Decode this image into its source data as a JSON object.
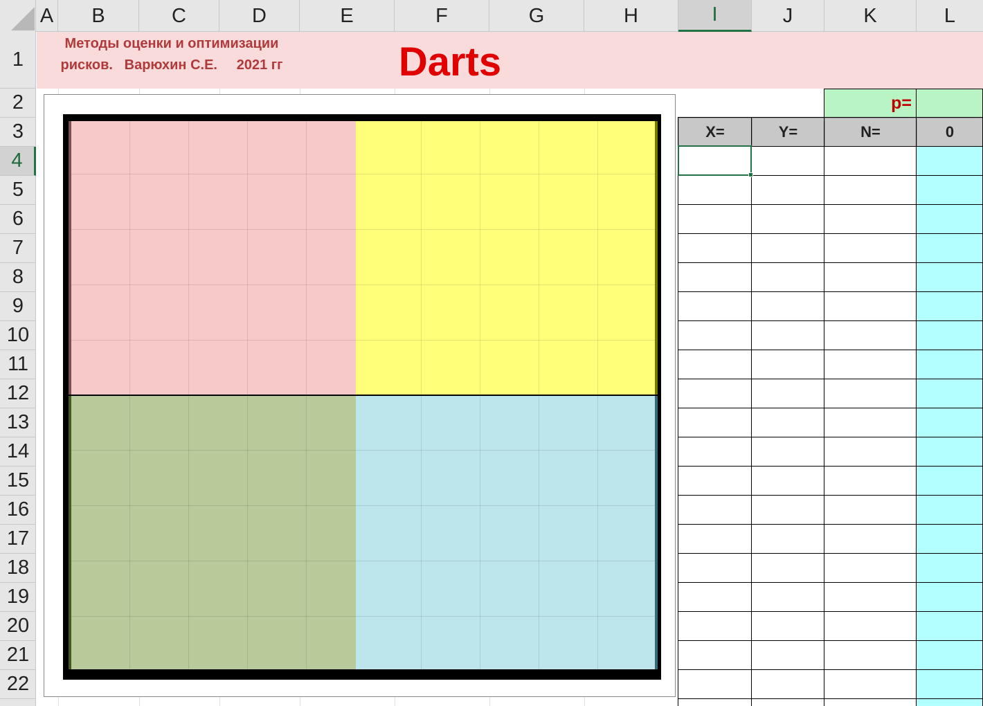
{
  "columns": [
    "A",
    "B",
    "C",
    "D",
    "E",
    "F",
    "G",
    "H",
    "I",
    "J",
    "K",
    "L"
  ],
  "selected_column": "I",
  "rows": [
    "1",
    "2",
    "3",
    "4",
    "5",
    "6",
    "7",
    "8",
    "9",
    "10",
    "11",
    "12",
    "13",
    "14",
    "15",
    "16",
    "17",
    "18",
    "19",
    "20",
    "21",
    "22"
  ],
  "selected_row": "4",
  "header": {
    "subtitle_line1": "Методы оценки и оптимизации",
    "subtitle_line2": "рисков.   Варюхин С.Е.     2021 гг",
    "title": "Darts"
  },
  "table": {
    "p_label": "p=",
    "p_value": "",
    "col_headers": [
      "X=",
      "Y=",
      "N=",
      "0"
    ]
  },
  "board": {
    "quadrant_colors": {
      "top_left": "#f7c9c9",
      "top_right": "#ffff7a",
      "bottom_left": "#b8c99a",
      "bottom_right": "#bde5ec"
    }
  },
  "colors": {
    "title": "#e00000",
    "subtitle": "#b03a3a",
    "header_band": "#fadbdc",
    "p_cell": "#b9f5c4",
    "l_column": "#b3ffff",
    "selection": "#217346"
  }
}
